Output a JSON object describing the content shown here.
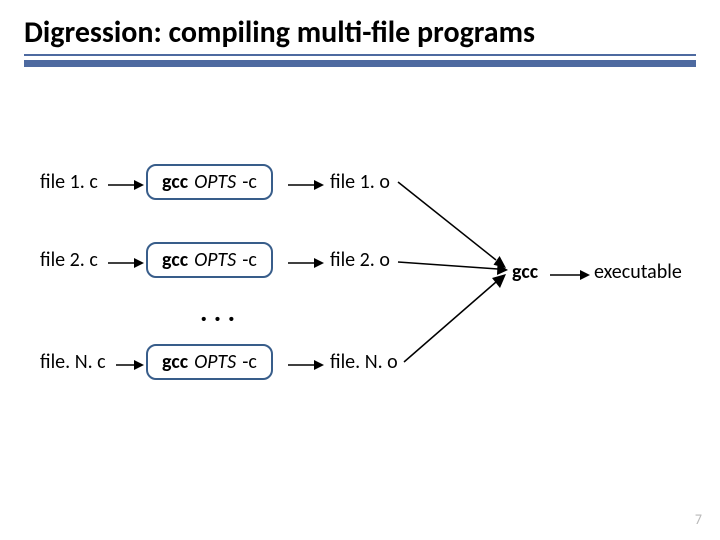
{
  "slide": {
    "title": "Digression: compiling multi-file programs",
    "page_number": "7"
  },
  "rows": [
    {
      "src": "file 1. c",
      "cmd": {
        "gcc": "gcc",
        "opts": "OPTS",
        "dashc": "-c"
      },
      "obj": "file 1. o"
    },
    {
      "src": "file 2. c",
      "cmd": {
        "gcc": "gcc",
        "opts": "OPTS",
        "dashc": "-c"
      },
      "obj": "file 2. o"
    },
    {
      "src": "file. N. c",
      "cmd": {
        "gcc": "gcc",
        "opts": "OPTS",
        "dashc": "-c"
      },
      "obj": "file. N. o"
    }
  ],
  "ellipsis": ". . .",
  "link": {
    "gcc": "gcc",
    "out": "executable"
  },
  "chart_data": {
    "type": "diagram",
    "title": "Compiling multi-file programs",
    "nodes": [
      {
        "id": "src1",
        "label": "file 1. c",
        "kind": "source"
      },
      {
        "id": "src2",
        "label": "file 2. c",
        "kind": "source"
      },
      {
        "id": "srcN",
        "label": "file. N. c",
        "kind": "source"
      },
      {
        "id": "cc1",
        "label": "gcc OPTS -c",
        "kind": "compile"
      },
      {
        "id": "cc2",
        "label": "gcc OPTS -c",
        "kind": "compile"
      },
      {
        "id": "ccN",
        "label": "gcc OPTS -c",
        "kind": "compile"
      },
      {
        "id": "obj1",
        "label": "file 1. o",
        "kind": "object"
      },
      {
        "id": "obj2",
        "label": "file 2. o",
        "kind": "object"
      },
      {
        "id": "objN",
        "label": "file. N. o",
        "kind": "object"
      },
      {
        "id": "ellipsis",
        "label": ". . .",
        "kind": "ellipsis"
      },
      {
        "id": "link",
        "label": "gcc",
        "kind": "link"
      },
      {
        "id": "exe",
        "label": "executable",
        "kind": "executable"
      }
    ],
    "edges": [
      [
        "src1",
        "cc1"
      ],
      [
        "cc1",
        "obj1"
      ],
      [
        "src2",
        "cc2"
      ],
      [
        "cc2",
        "obj2"
      ],
      [
        "srcN",
        "ccN"
      ],
      [
        "ccN",
        "objN"
      ],
      [
        "obj1",
        "link"
      ],
      [
        "obj2",
        "link"
      ],
      [
        "objN",
        "link"
      ],
      [
        "link",
        "exe"
      ]
    ]
  }
}
